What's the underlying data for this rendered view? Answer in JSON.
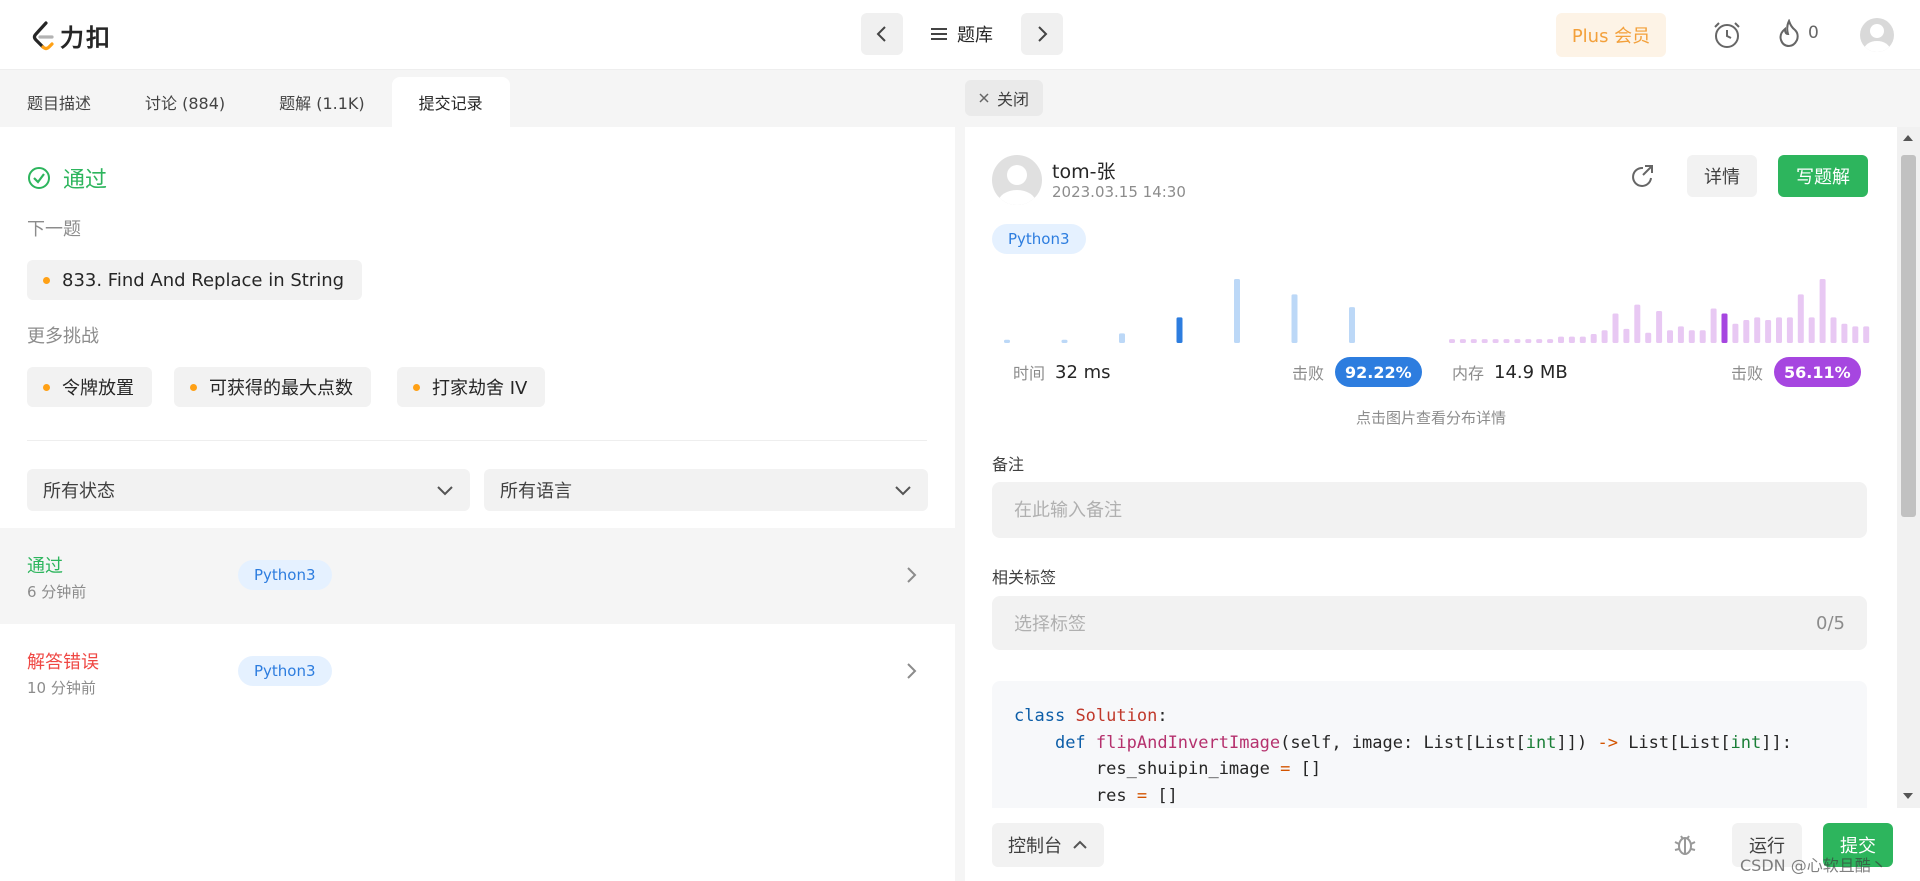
{
  "brand": {
    "name": "力扣",
    "accent": "#ffa116"
  },
  "topnav": {
    "library_label": "题库",
    "plus_label": "Plus 会员",
    "streak_count": "0"
  },
  "left_tabs": [
    {
      "label": "题目描述"
    },
    {
      "label": "讨论 (884)"
    },
    {
      "label": "题解 (1.1K)"
    },
    {
      "label": "提交记录"
    }
  ],
  "result": {
    "status": "通过"
  },
  "next": {
    "label": "下一题",
    "problem": "833. Find And Replace in String"
  },
  "more": {
    "label": "更多挑战",
    "items": [
      "令牌放置",
      "可获得的最大点数",
      "打家劫舍 IV"
    ]
  },
  "filters": {
    "status": "所有状态",
    "language": "所有语言"
  },
  "submissions": [
    {
      "status": "通过",
      "time": "6 分钟前",
      "lang": "Python3",
      "color": "#2db55d"
    },
    {
      "status": "解答错误",
      "time": "10 分钟前",
      "lang": "Python3",
      "color": "#ef4743"
    }
  ],
  "right_tabs": {
    "close_label": "关闭"
  },
  "detail": {
    "user": "tom-张",
    "date": "2023.03.15 14:30",
    "detail_btn": "详情",
    "write_btn": "写题解",
    "lang": "Python3",
    "runtime_label": "时间",
    "runtime": "32 ms",
    "beat_label": "击败",
    "runtime_beat": "92.22%",
    "memory_label": "内存",
    "memory": "14.9 MB",
    "memory_beat": "56.11%",
    "chart_hint": "点击图片查看分布详情",
    "note_label": "备注",
    "note_placeholder": "在此输入备注",
    "tags_label": "相关标签",
    "tags_placeholder": "选择标签",
    "tags_count": "0/5"
  },
  "code_lines": [
    "class Solution:",
    "    def flipAndInvertImage(self, image: List[List[int]]) -> List[List[int]]:",
    "        res_shuipin_image = []",
    "        res = []"
  ],
  "bottom": {
    "console": "控制台",
    "run": "运行",
    "submit": "提交"
  },
  "watermark": "CSDN @心软且酷丶",
  "chart_data": [
    {
      "type": "bar",
      "name": "runtime",
      "values": [
        0.05,
        0.05,
        0.15,
        0.4,
        1.0,
        0.76,
        0.56
      ],
      "highlight": 3,
      "color": "#bcd8f7",
      "highlight_color": "#2d7ddf"
    },
    {
      "type": "bar",
      "name": "memory",
      "values": [
        0.06,
        0.06,
        0.06,
        0.06,
        0.06,
        0.06,
        0.06,
        0.06,
        0.06,
        0.06,
        0.1,
        0.1,
        0.1,
        0.14,
        0.2,
        0.46,
        0.22,
        0.6,
        0.16,
        0.5,
        0.2,
        0.26,
        0.2,
        0.2,
        0.54,
        0.46,
        0.3,
        0.36,
        0.4,
        0.36,
        0.4,
        0.4,
        0.76,
        0.4,
        1.0,
        0.4,
        0.3,
        0.26,
        0.26,
        0.36
      ],
      "highlight": 25,
      "color": "#e8c8f3",
      "highlight_color": "#a646e0"
    }
  ]
}
